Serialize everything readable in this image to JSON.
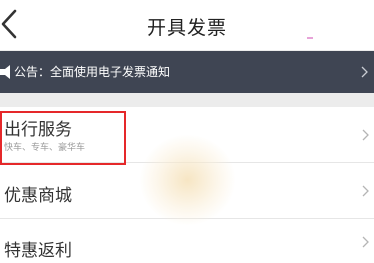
{
  "header": {
    "title": "开具发票"
  },
  "notice": {
    "text": "公告：全面使用电子发票通知"
  },
  "menu": {
    "items": [
      {
        "title": "出行服务",
        "subtitle": "快车、专车、豪华车"
      },
      {
        "title": "优惠商城"
      },
      {
        "title": "特惠返利"
      }
    ]
  },
  "colors": {
    "notice_bg": "#3f4553",
    "highlight_border": "#e5282a",
    "page_bg": "#ececec"
  },
  "icons": {
    "back": "chevron-left-icon",
    "speaker": "speaker-icon",
    "row_arrow": "chevron-right-icon"
  }
}
